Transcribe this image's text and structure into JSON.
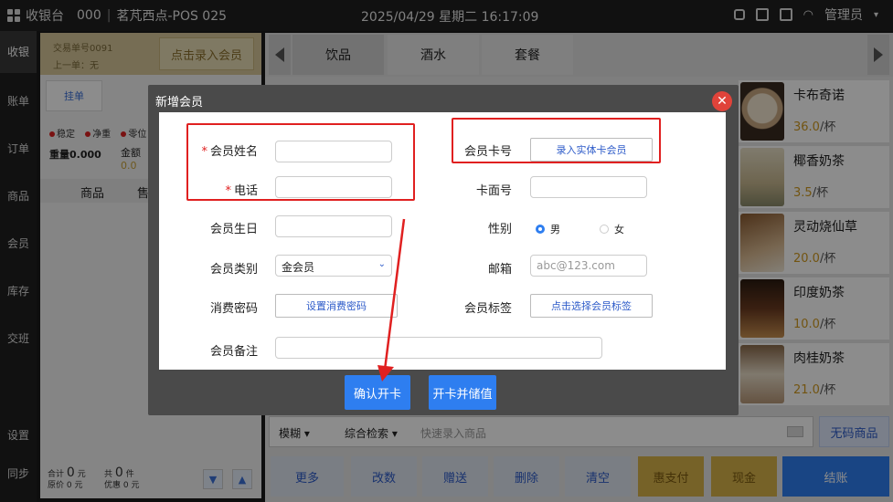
{
  "topbar": {
    "app_name": "收银台",
    "store_code": "000",
    "store_name": "茗芃西点-POS 025",
    "datetime": "2025/04/29 星期二 16:17:09",
    "user": "管理员"
  },
  "leftnav": {
    "items": [
      "收银",
      "账单",
      "订单",
      "商品",
      "会员",
      "库存",
      "交班",
      "设置",
      "同步"
    ]
  },
  "order": {
    "trade_no": "交易单号0091",
    "last_order": "上一单：无",
    "member_button": "点击录入会员",
    "hang_button": "挂单",
    "scale_labels": [
      "稳定",
      "净重",
      "零位"
    ],
    "weight_label": "重量0.000",
    "amount_label": "金额",
    "amount_value": "0.0",
    "col_goods": "商品",
    "col_price": "售",
    "total_label": "合计",
    "total_value": "0",
    "total_unit": "元",
    "orig_label": "原价",
    "orig_value": "0",
    "orig_unit": "元",
    "count_label": "共",
    "count_value": "0",
    "count_unit": "件",
    "discount_label": "优惠",
    "discount_value": "0",
    "discount_unit": "元",
    "down_icon": "chevron-down-icon",
    "up_icon": "chevron-up-icon"
  },
  "categories": {
    "tabs": [
      "饮品",
      "酒水",
      "套餐"
    ],
    "active": "饮品"
  },
  "products": [
    {
      "name": "卡布奇诺",
      "price": "36.0",
      "unit": "/杯",
      "color": "#c8a882"
    },
    {
      "name": "椰香奶茶",
      "price": "3.5",
      "unit": "/杯",
      "color": "#d8d0b8"
    },
    {
      "name": "灵动烧仙草",
      "price": "20.0",
      "unit": "/杯",
      "color": "#8a5a30"
    },
    {
      "name": "印度奶茶",
      "price": "10.0",
      "unit": "/杯",
      "color": "#6a3a20"
    },
    {
      "name": "肉桂奶茶",
      "price": "21.0",
      "unit": "/杯",
      "color": "#b89878"
    }
  ],
  "search": {
    "mode": "模糊",
    "type": "综合检索",
    "placeholder": "快速录入商品",
    "nocode_button": "无码商品"
  },
  "actions": {
    "more": "更多",
    "change_qty": "改数",
    "gift": "赠送",
    "delete": "删除",
    "clear": "清空",
    "huizhifu": "惠支付",
    "cash": "现金",
    "checkout": "结账"
  },
  "dialog": {
    "title": "新增会员",
    "close_icon": "close-icon",
    "name_label": "会员姓名",
    "phone_label": "电话",
    "birthday_label": "会员生日",
    "type_label": "会员类别",
    "type_value": "金会员",
    "password_label": "消费密码",
    "password_button": "设置消费密码",
    "note_label": "会员备注",
    "card_no_label": "会员卡号",
    "card_no_button": "录入实体卡会员",
    "face_no_label": "卡面号",
    "gender_label": "性别",
    "gender_male": "男",
    "gender_female": "女",
    "email_label": "邮箱",
    "email_placeholder": "abc@123.com",
    "tag_label": "会员标签",
    "tag_button": "点击选择会员标签",
    "confirm_button": "确认开卡",
    "confirm_store_button": "开卡并储值",
    "required_mark": "*"
  }
}
